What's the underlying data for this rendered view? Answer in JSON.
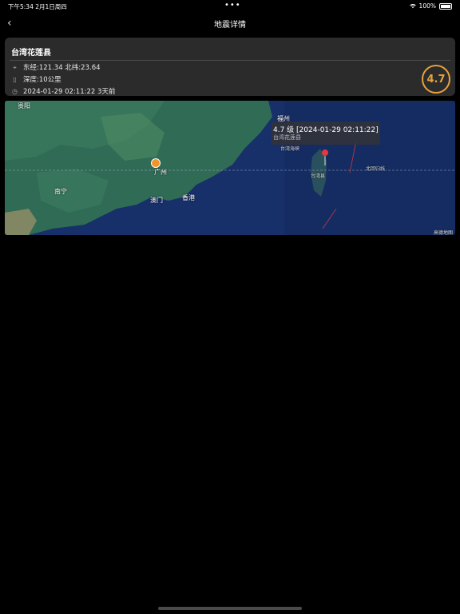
{
  "status_bar": {
    "time": "下午5:34  2月1日周四",
    "battery": "100%"
  },
  "nav": {
    "title": "地震详情",
    "back_icon": "chevron-left-icon"
  },
  "quake": {
    "location": "台湾花莲县",
    "coords": "东经:121.34  北纬:23.64",
    "depth": "深度:10公里",
    "time": "2024-01-29 02:11:22   3天前",
    "magnitude": "4.7",
    "accent": "#e8a23c"
  },
  "map": {
    "callout_title": "4.7 级  [2024-01-29 02:11:22]",
    "callout_sub": "台湾花莲县",
    "labels": {
      "guiyang": "贵阳",
      "fuzhou": "福州",
      "guangzhou": "广州",
      "nanning": "南宁",
      "aomen": "澳门",
      "xianggang": "香港",
      "taiwan_strait": "台湾海峡",
      "taiwan_city": "台湾县",
      "beigui": "北回归线",
      "attribution": "高德地图"
    }
  }
}
